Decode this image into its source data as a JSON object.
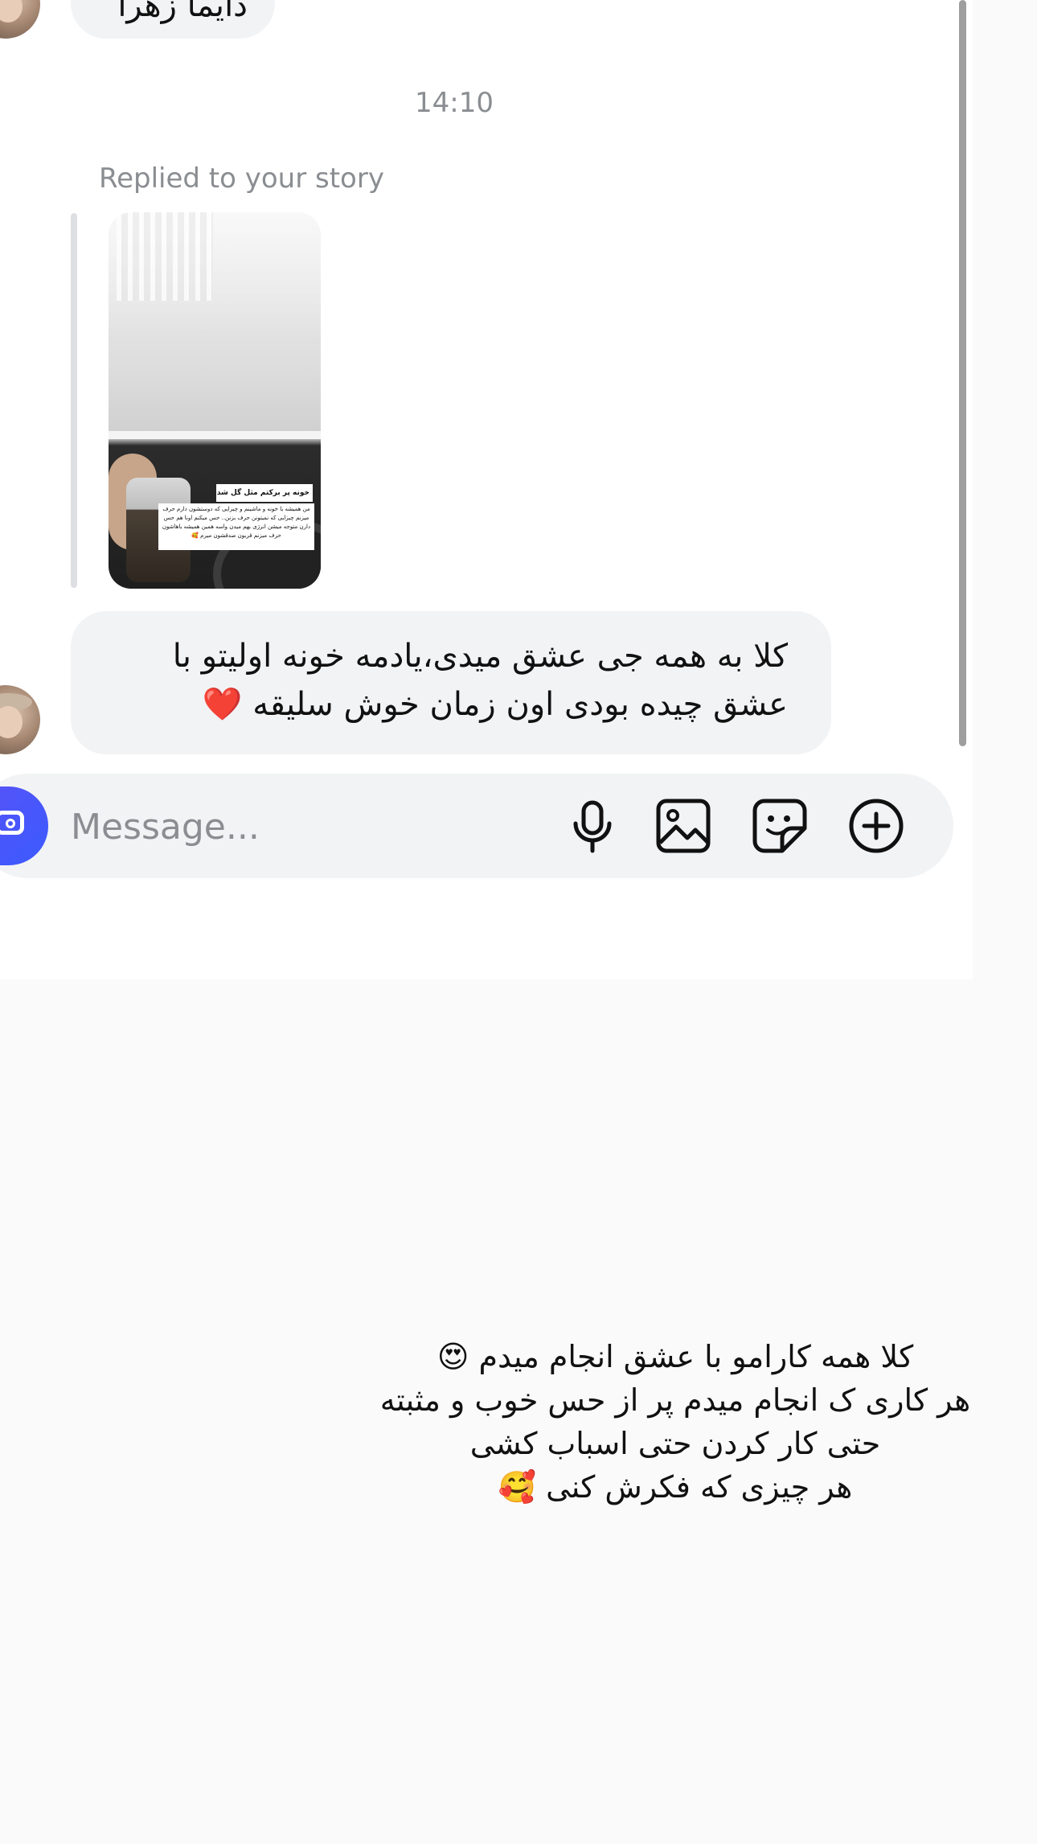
{
  "top_message": {
    "text": "دایما زهرا"
  },
  "timestamp": "14:10",
  "reply": {
    "label": "Replied to your story",
    "story_caption_title": "خونه پر برکتم مثل گل شد 😍",
    "story_caption_body": "من همیشه با خونه و ماشینم و چیزایی که دوستشون دارم حرف میزنم چیزایی که نمیتونن حرف بزنن.. حس میکنم اونا هم حس دارن متوجه میشن انرژی بهم میدن واسه همین همیشه باهاشون حرف میزنم قربون صدقشون میرم 🥰"
  },
  "message": {
    "text": "کلا به همه جی عشق میدی،یادمه خونه اولیتو با عشق چیده بودی اون زمان خوش سلیقه ❤️"
  },
  "composer": {
    "placeholder": "Message..."
  },
  "icons": {
    "camera": "camera-icon",
    "mic": "microphone-icon",
    "image": "gallery-icon",
    "sticker": "sticker-icon",
    "plus": "plus-circle-icon"
  },
  "story_text": {
    "lines": [
      "کلا همه کارامو با عشق انجام میدم 😍",
      "هر کاری ک انجام میدم پر از حس خوب و مثبته",
      "حتی کار کردن حتی اسباب کشی",
      "هر چیزی که فکرش کنی 🥰"
    ]
  },
  "colors": {
    "accent": "#3b5bff",
    "bubble": "#f2f3f5",
    "muted_text": "#8a8d91"
  }
}
